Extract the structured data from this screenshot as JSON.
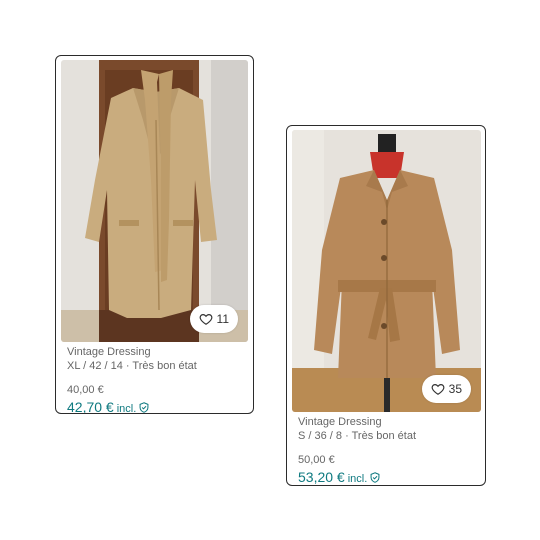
{
  "items": [
    {
      "brand": "Vintage Dressing",
      "details": "XL / 42 / 14 · Très bon état",
      "price": "40,00 €",
      "total_price": "42,70 €",
      "incl_label": "incl.",
      "favorites": "11"
    },
    {
      "brand": "Vintage Dressing",
      "details": "S / 36 / 8 · Très bon état",
      "price": "50,00 €",
      "total_price": "53,20 €",
      "incl_label": "incl.",
      "favorites": "35"
    }
  ],
  "colors": {
    "accent": "#0f7a80",
    "secondary_text": "#666666",
    "card_border": "#2b2b2b"
  },
  "icons": {
    "favorite": "heart-icon",
    "buyer_protection": "shield-check-icon"
  }
}
